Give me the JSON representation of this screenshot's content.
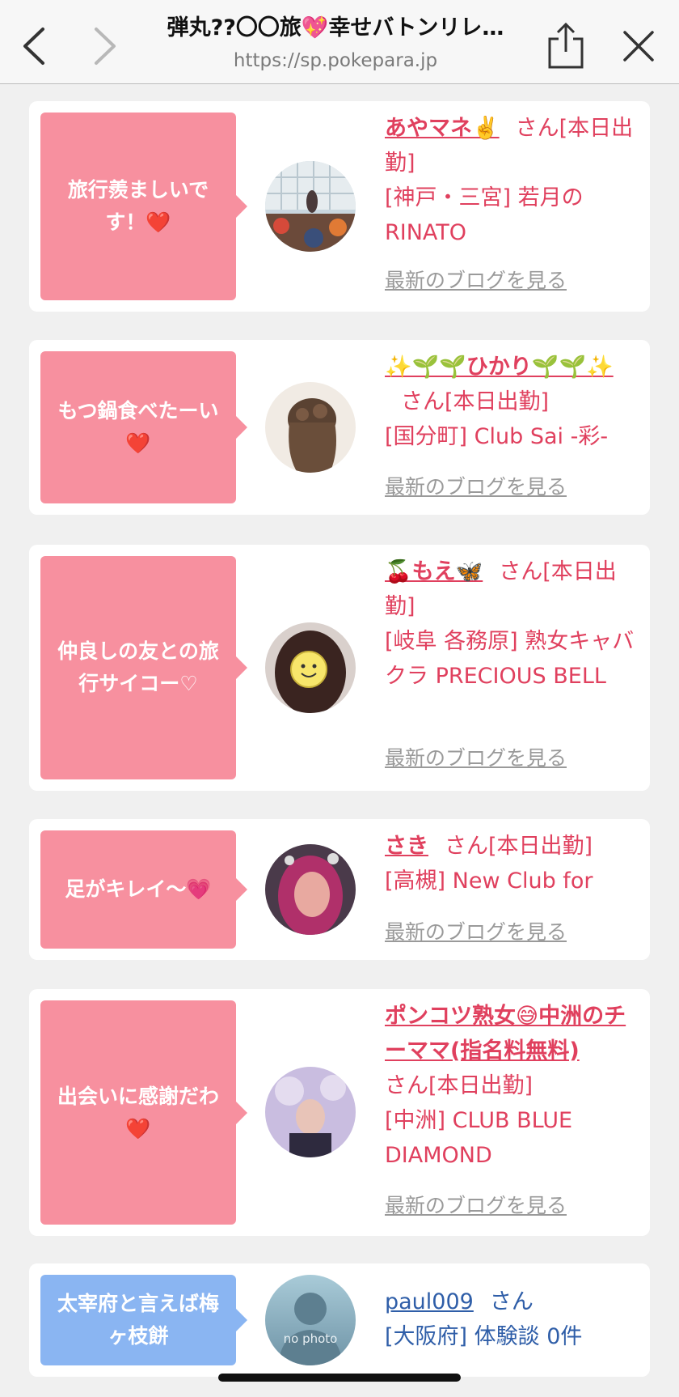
{
  "browser": {
    "title": "弾丸??〇〇旅💖幸せバトンリレ…",
    "url": "https://sp.pokepara.jp"
  },
  "blog_link_label": "最新のブログを見る",
  "cards": [
    {
      "message": "旅行羨ましいです！❤️",
      "name": "あやマネ✌️",
      "status": "さん[本日出勤]",
      "shop": "[神戸・三宮] 若月のRINATO",
      "blog": "最新のブログを見る"
    },
    {
      "message": "もつ鍋食べたーい❤️",
      "name": "✨🌱🌱ひかり🌱🌱✨",
      "status": "さん[本日出勤]",
      "shop": "[国分町] Club Sai -彩-",
      "blog": "最新のブログを見る"
    },
    {
      "message": "仲良しの友との旅行サイコー♡",
      "name": "🍒もえ🦋",
      "status": "さん[本日出勤]",
      "shop": "[岐阜 各務原]  熟女キャバクラ PRECIOUS BELL",
      "blog": "最新のブログを見る"
    },
    {
      "message": "足がキレイ〜💗",
      "name": "さき",
      "status": "さん[本日出勤]",
      "shop": "[高槻] New Club for",
      "blog": "最新のブログを見る"
    },
    {
      "message": "出会いに感謝だわ❤️",
      "name": "ポンコツ熟女😅中洲のチーママ(指名料無料)",
      "status": "さん[本日出勤]",
      "shop": "[中洲] CLUB BLUE DIAMOND",
      "blog": "最新のブログを見る"
    },
    {
      "message": "太宰府と言えば梅ヶ枝餅",
      "name": "paul009",
      "status": "さん",
      "shop": "[大阪府] 体験談 0件",
      "avatar_text": "no photo"
    }
  ],
  "colors": {
    "pink_bubble": "#f7909f",
    "blue_bubble": "#8ab5f2",
    "pink_text": "#e0405e",
    "blue_text": "#2f5ea8"
  }
}
